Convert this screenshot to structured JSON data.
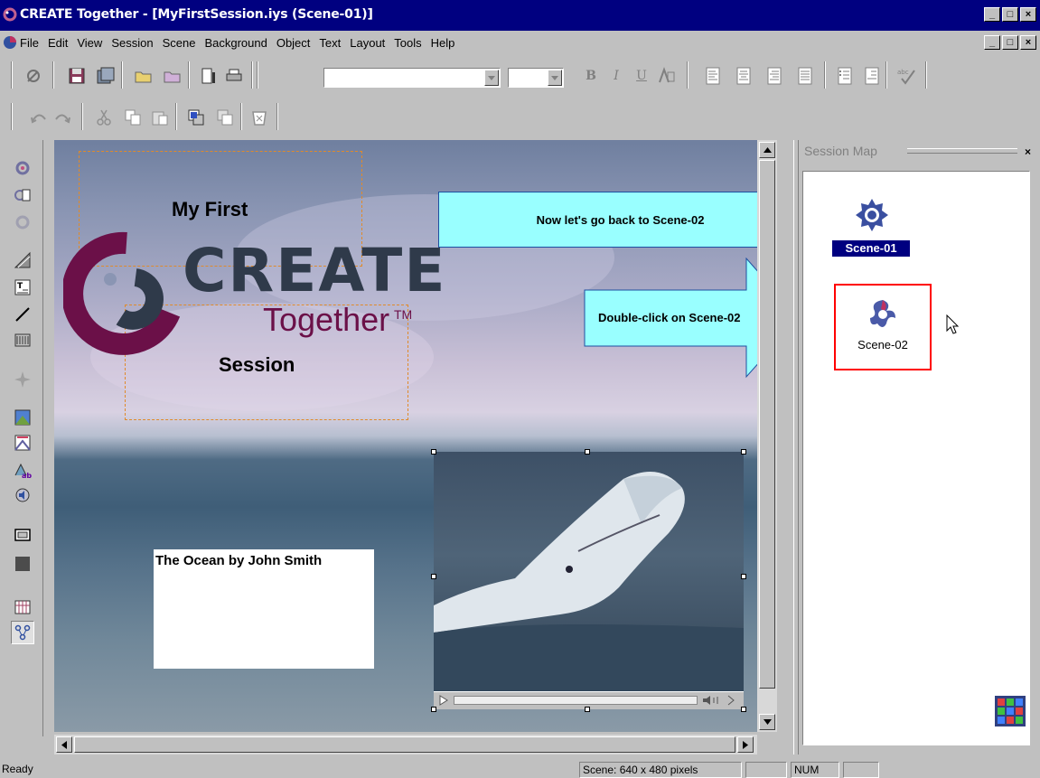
{
  "window": {
    "title": "CREATE Together - [MyFirstSession.iys (Scene-01)]",
    "buttons": {
      "minimize": "_",
      "maximize": "□",
      "close": "×"
    }
  },
  "menubar": {
    "items": [
      "File",
      "Edit",
      "View",
      "Session",
      "Scene",
      "Background",
      "Object",
      "Text",
      "Layout",
      "Tools",
      "Help"
    ]
  },
  "toolbar": {
    "font_name": "",
    "font_size": "",
    "bold": "B",
    "italic": "I",
    "underline": "U"
  },
  "canvas": {
    "heading_top": "My First",
    "logo_word": "CREATE",
    "logo_sub": "Together",
    "logo_tm": "TM",
    "heading_bottom": "Session",
    "callout_back": "Now let's go back to Scene-02",
    "callout_double_click": "Double-click on Scene-02",
    "textbox": "The Ocean by John Smith"
  },
  "session_map": {
    "title": "Session Map",
    "close": "×",
    "scenes": [
      {
        "label": "Scene-01",
        "selected": true
      },
      {
        "label": "Scene-02",
        "selected": false
      }
    ]
  },
  "statusbar": {
    "message": "Ready",
    "scene_size": "Scene: 640 x 480 pixels",
    "num": "NUM"
  },
  "colors": {
    "title_bg": "#000080",
    "callout_fill": "#99ffff",
    "logo_purple": "#6b1048",
    "logo_slate": "#2f3a4a",
    "highlight_red": "#ff0000"
  }
}
